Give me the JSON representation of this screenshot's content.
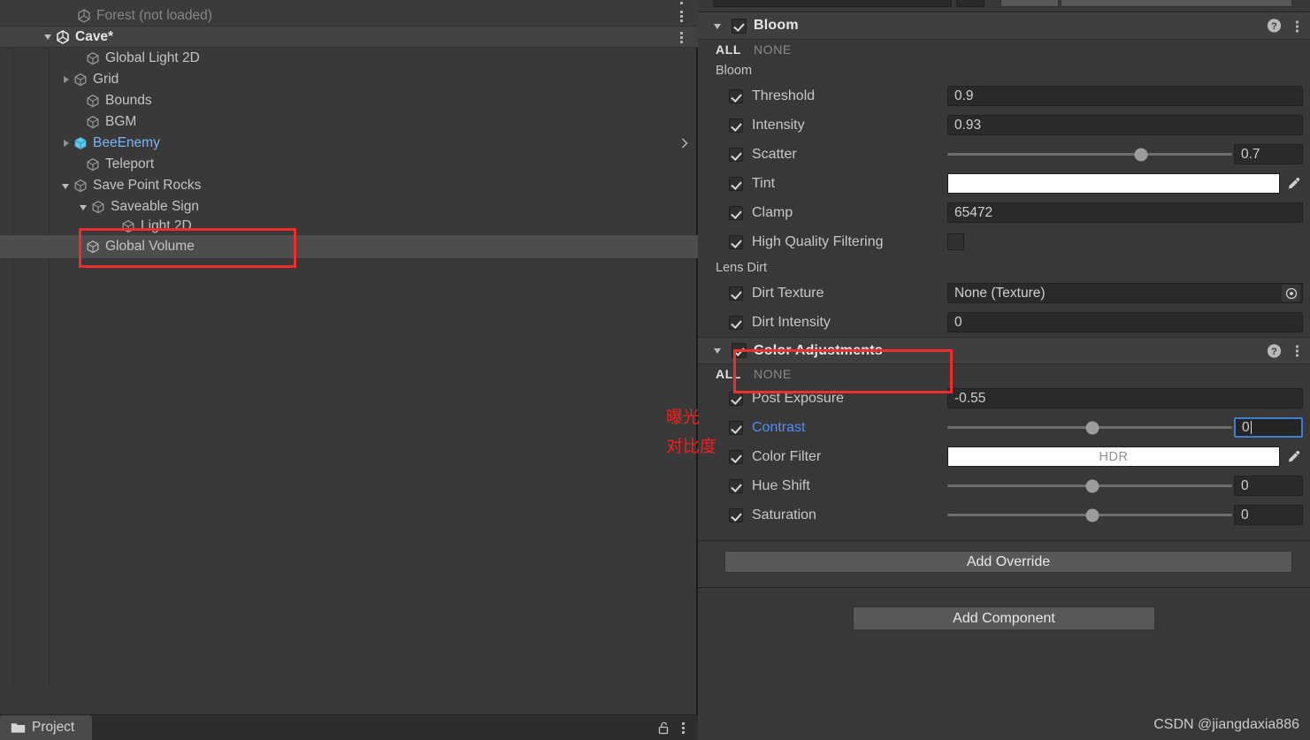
{
  "hierarchy": {
    "rows": [
      {
        "label": "",
        "indent": 3,
        "partial": true,
        "icon": "none",
        "foldout": "none",
        "kebab": false,
        "style": "normal"
      },
      {
        "label": "Forest (not loaded)",
        "indent": 3,
        "icon": "unity-scene-icon",
        "foldout": "none",
        "kebab": true,
        "style": "dimmed"
      },
      {
        "label": "Cave*",
        "indent": 2,
        "icon": "unity-scene-icon",
        "foldout": "open",
        "kebab": true,
        "style": "scene-header"
      },
      {
        "label": "Global Light 2D",
        "indent": 4,
        "icon": "gameobject-cube-icon",
        "foldout": "none",
        "kebab": false,
        "style": "normal"
      },
      {
        "label": "Grid",
        "indent": 4,
        "icon": "gameobject-cube-icon",
        "foldout": "closed",
        "kebab": false,
        "style": "normal"
      },
      {
        "label": "Bounds",
        "indent": 4,
        "icon": "gameobject-cube-icon",
        "foldout": "none",
        "kebab": false,
        "style": "normal"
      },
      {
        "label": "BGM",
        "indent": 4,
        "icon": "gameobject-cube-icon",
        "foldout": "none",
        "kebab": false,
        "style": "normal"
      },
      {
        "label": "BeeEnemy",
        "indent": 4,
        "icon": "prefab-cube-icon",
        "foldout": "closed",
        "kebab": false,
        "style": "prefab",
        "chevron": true
      },
      {
        "label": "Teleport",
        "indent": 4,
        "icon": "gameobject-cube-icon",
        "foldout": "none",
        "kebab": false,
        "style": "normal"
      },
      {
        "label": "Save Point Rocks",
        "indent": 4,
        "icon": "gameobject-cube-icon",
        "foldout": "open",
        "kebab": false,
        "style": "normal"
      },
      {
        "label": "Saveable Sign",
        "indent": 5,
        "icon": "gameobject-cube-icon",
        "foldout": "open",
        "kebab": false,
        "style": "normal"
      },
      {
        "label": "Light 2D",
        "indent": 6,
        "icon": "gameobject-cube-icon",
        "foldout": "none",
        "kebab": false,
        "style": "normal"
      },
      {
        "label": "Global Volume",
        "indent": 4,
        "icon": "gameobject-cube-icon",
        "foldout": "none",
        "kebab": false,
        "style": "selected"
      }
    ],
    "project_tab": {
      "label": "Project",
      "icon": "folder-icon",
      "lock_icon": "lock-open-icon",
      "menu_icon": "kebab-menu-icon"
    }
  },
  "inspector": {
    "bloom": {
      "title": "Bloom",
      "enabled": true,
      "expanded": true,
      "all_label": "ALL",
      "none_label": "NONE",
      "help_icon": "help-icon",
      "menu_icon": "kebab-menu-icon",
      "groups": [
        {
          "group_label": "Bloom",
          "props": [
            {
              "label": "Threshold",
              "checked": true,
              "kind": "text",
              "value": "0.9"
            },
            {
              "label": "Intensity",
              "checked": true,
              "kind": "text",
              "value": "0.93"
            },
            {
              "label": "Scatter",
              "checked": true,
              "kind": "slider",
              "value": "0.7",
              "knob_pct": 68
            },
            {
              "label": "Tint",
              "checked": true,
              "kind": "color",
              "value": "",
              "swatch": "#ffffff",
              "eyedropper": true
            },
            {
              "label": "Clamp",
              "checked": true,
              "kind": "text",
              "value": "65472"
            },
            {
              "label": "High Quality Filtering",
              "checked": true,
              "kind": "checkbox",
              "value": "",
              "box_checked": false
            }
          ]
        },
        {
          "group_label": "Lens Dirt",
          "props": [
            {
              "label": "Dirt Texture",
              "checked": true,
              "kind": "object",
              "value": "None (Texture)",
              "picker_icon": "object-picker-icon"
            },
            {
              "label": "Dirt Intensity",
              "checked": true,
              "kind": "text",
              "value": "0"
            }
          ]
        }
      ]
    },
    "color_adjustments": {
      "title": "Color Adjustments",
      "enabled": true,
      "expanded": true,
      "all_label": "ALL",
      "none_label": "NONE",
      "help_icon": "help-icon",
      "menu_icon": "kebab-menu-icon",
      "props": [
        {
          "label": "Post Exposure",
          "checked": true,
          "kind": "text",
          "value": "-0.55"
        },
        {
          "label": "Contrast",
          "checked": true,
          "kind": "slider",
          "value": "0",
          "knob_pct": 51,
          "focused": true,
          "label_highlight": true
        },
        {
          "label": "Color Filter",
          "checked": true,
          "kind": "color",
          "value": "HDR",
          "swatch": "#ffffff",
          "eyedropper": true
        },
        {
          "label": "Hue Shift",
          "checked": true,
          "kind": "slider",
          "value": "0",
          "knob_pct": 51
        },
        {
          "label": "Saturation",
          "checked": true,
          "kind": "slider",
          "value": "0",
          "knob_pct": 51
        }
      ]
    },
    "add_override_label": "Add Override",
    "add_component_label": "Add Component",
    "watermark": "CSDN @jiangdaxia886"
  },
  "annotations": {
    "exposure_note": "曝光",
    "contrast_note": "对比度",
    "box_color": "#f22b2b"
  }
}
